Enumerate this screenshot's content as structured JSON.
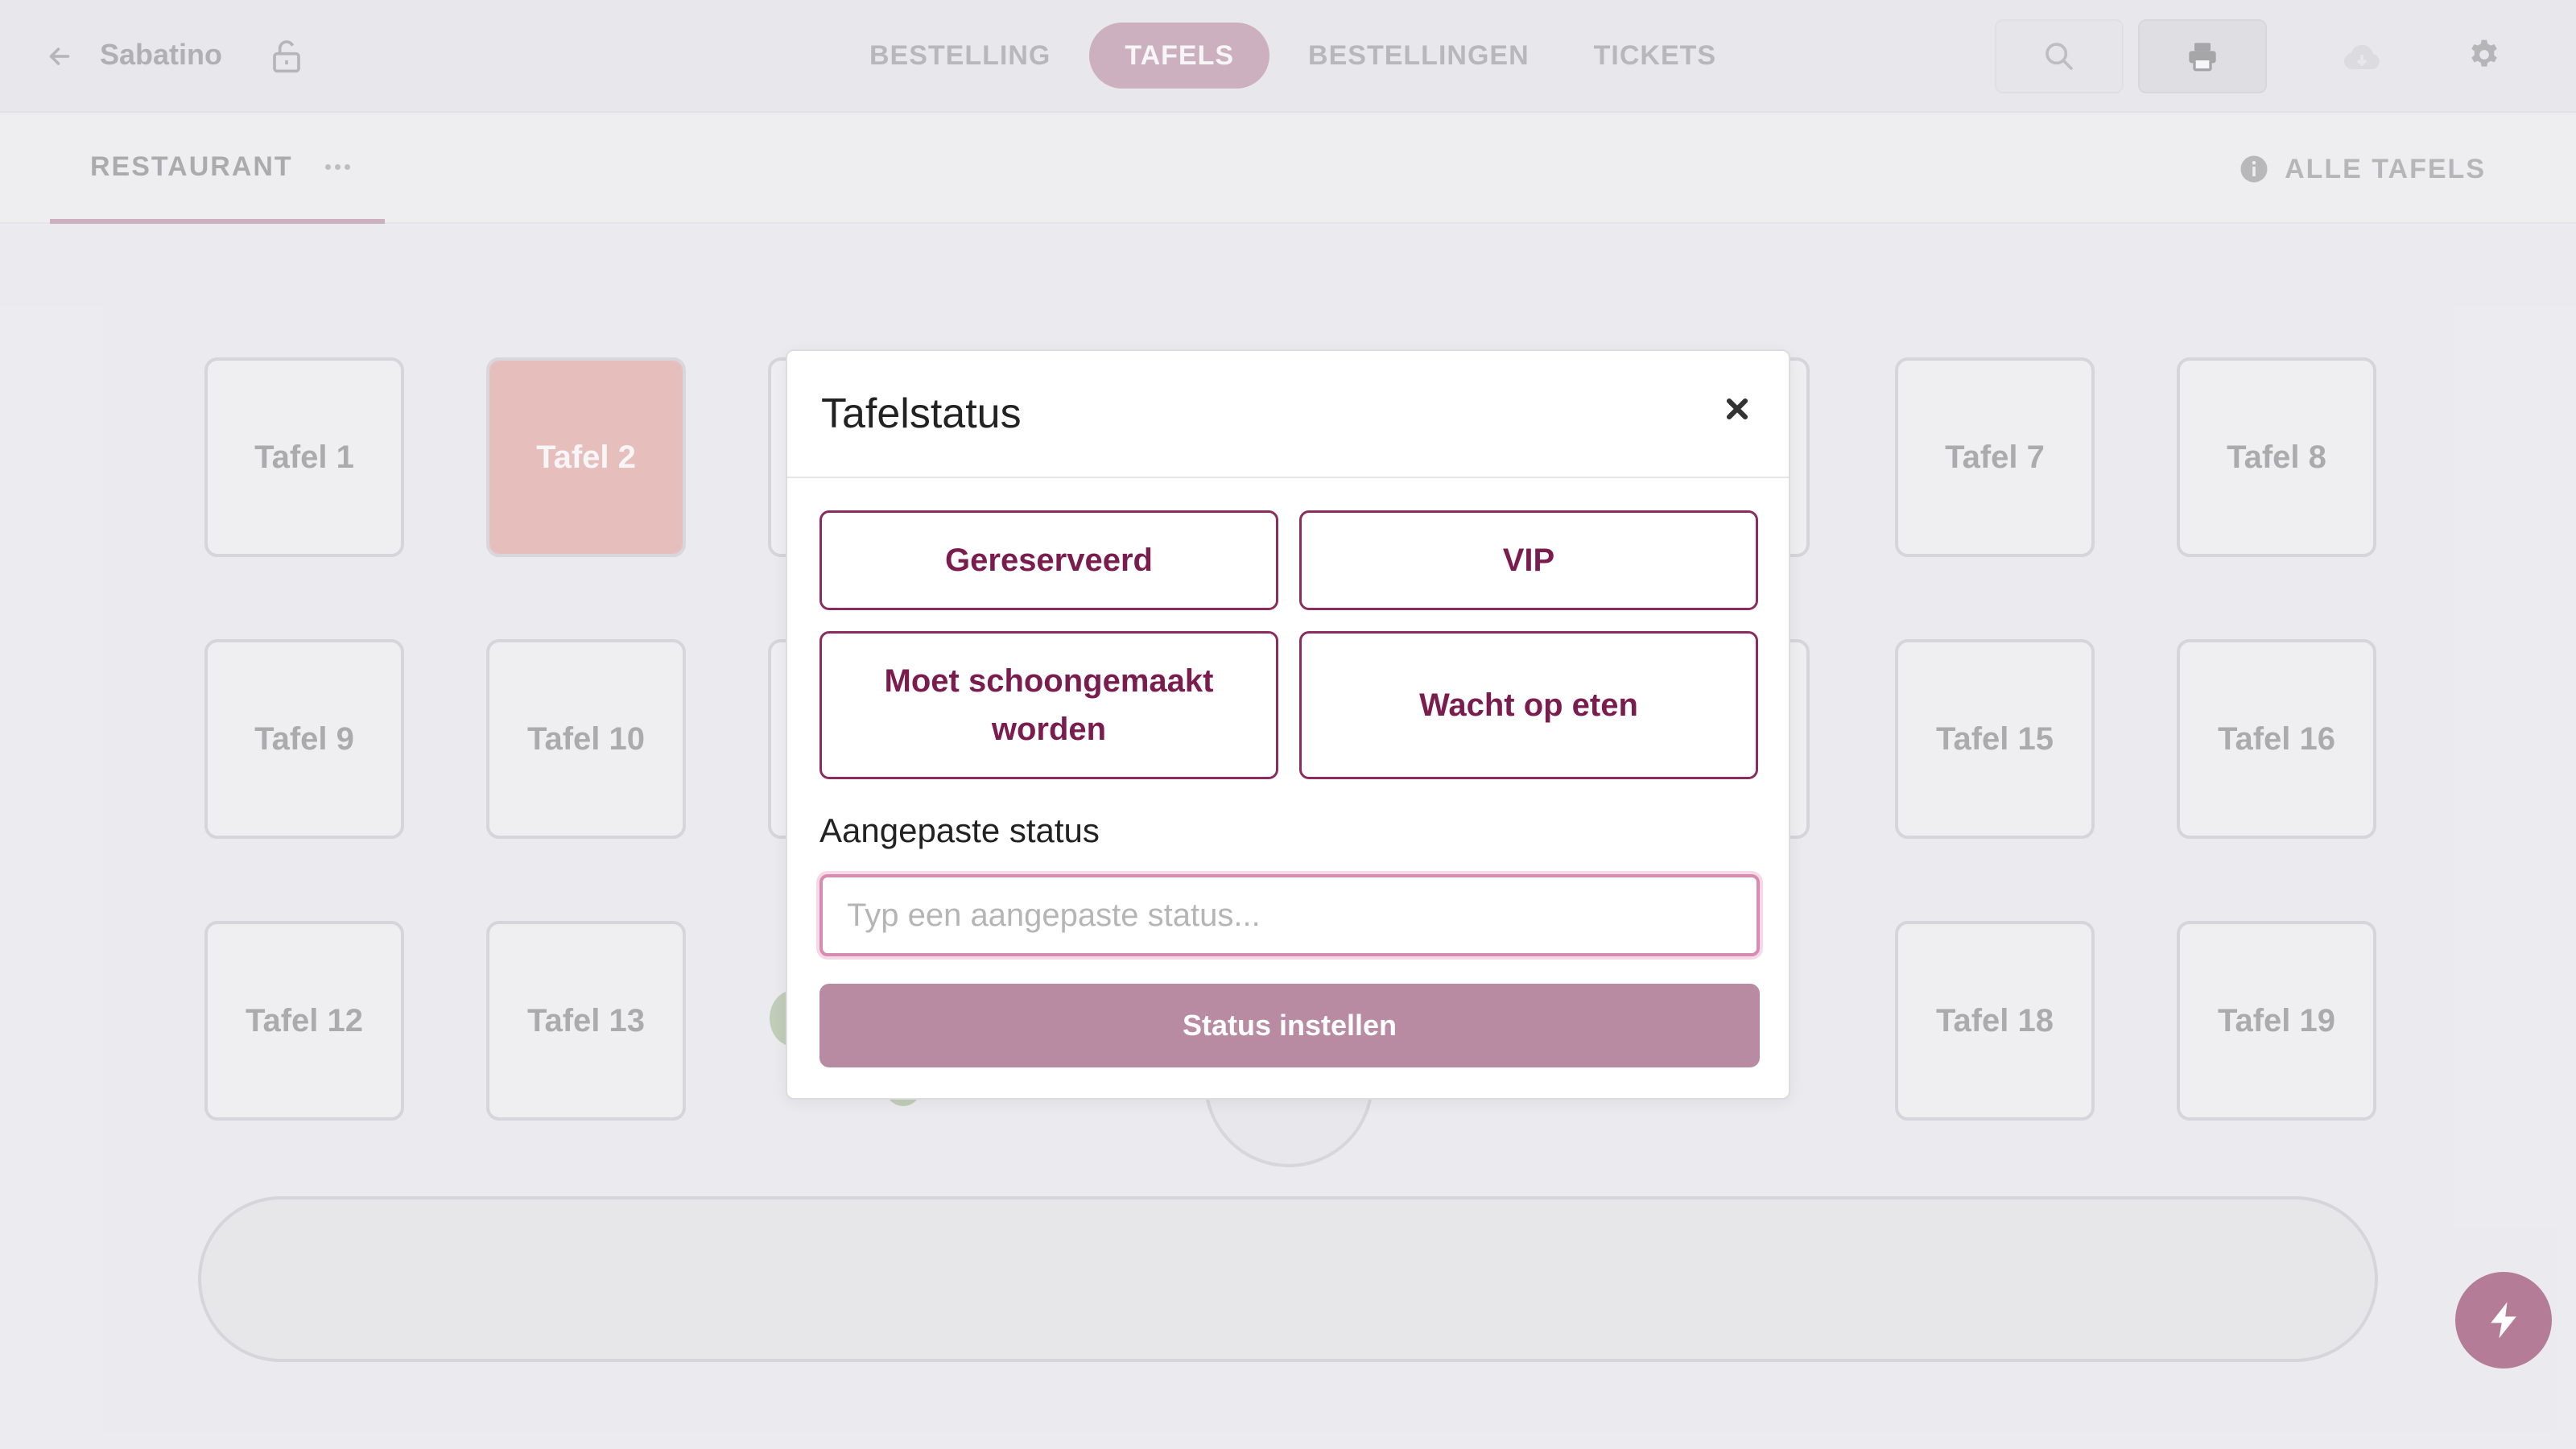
{
  "header": {
    "app_name": "Sabatino",
    "nav_tabs": [
      "BESTELLING",
      "TAFELS",
      "BESTELLINGEN",
      "TICKETS"
    ],
    "active_tab": "TAFELS",
    "icons": [
      "back-arrow-icon",
      "lock-icon",
      "search-icon",
      "printer-icon",
      "cloud-icon",
      "gear-icon"
    ]
  },
  "subbar": {
    "room_tab": "RESTAURANT",
    "all_tables": "ALLE TAFELS"
  },
  "tables": [
    {
      "label": "Tafel 1",
      "status": "free"
    },
    {
      "label": "Tafel 2",
      "status": "occupied"
    },
    {
      "label": "Tafel 7",
      "status": "free"
    },
    {
      "label": "Tafel 8",
      "status": "free"
    },
    {
      "label": "Tafel 9",
      "status": "free"
    },
    {
      "label": "Tafel 10",
      "status": "free"
    },
    {
      "label": "Tafel 15",
      "status": "free"
    },
    {
      "label": "Tafel 16",
      "status": "free"
    },
    {
      "label": "Tafel 12",
      "status": "free"
    },
    {
      "label": "Tafel 13",
      "status": "free"
    },
    {
      "label": "Tafel 18",
      "status": "free"
    },
    {
      "label": "Tafel 19",
      "status": "free"
    }
  ],
  "modal": {
    "title": "Tafelstatus",
    "status_options": [
      "Gereserveerd",
      "VIP",
      "Moet schoongemaakt worden",
      "Wacht op eten"
    ],
    "custom_label": "Aangepaste status",
    "custom_placeholder": "Typ een aangepaste status...",
    "custom_value": "",
    "submit_label": "Status instellen"
  },
  "colors": {
    "accent": "#B5809A",
    "occupied": "#E29C94",
    "status_button_text": "#7A1D4E",
    "submit_button": "#B98BA2"
  }
}
